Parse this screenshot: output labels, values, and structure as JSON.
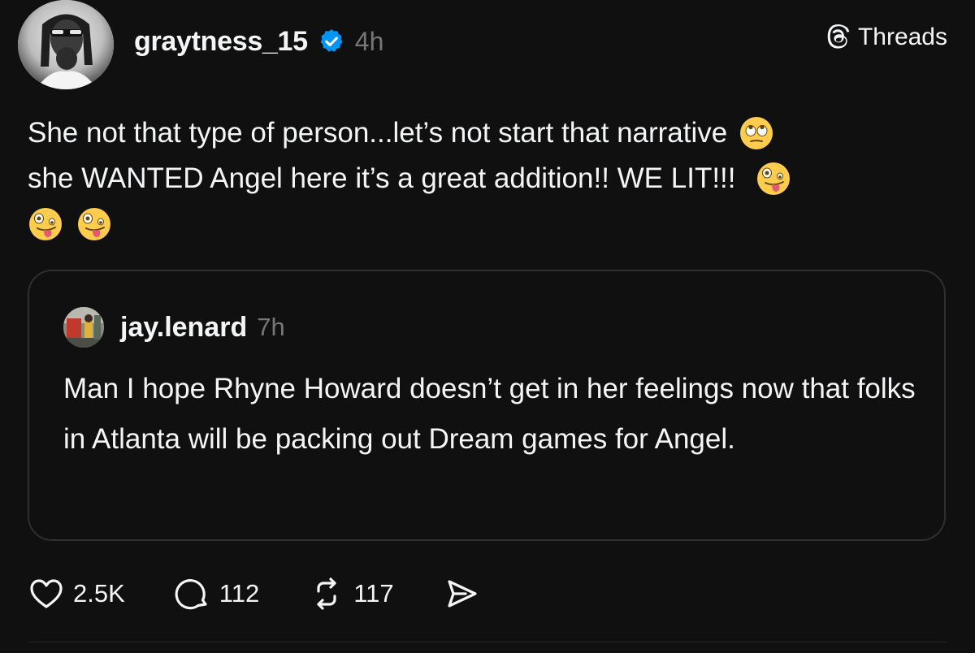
{
  "post": {
    "author": {
      "username": "graytness_15",
      "time": "4h",
      "verified": true
    },
    "brand": {
      "label": "Threads",
      "icon": "threads-logo-icon"
    },
    "text_lines": [
      "She not that type of person...let’s not start that narrative",
      "she WANTED Angel here it’s a great addition!! WE LIT!!!"
    ],
    "emojis": {
      "line1": [
        "face-with-rolling-eyes-emoji"
      ],
      "line2": [
        "zany-face-emoji"
      ],
      "line3": [
        "zany-face-emoji",
        "zany-face-emoji"
      ]
    },
    "quoted_post": {
      "username": "jay.lenard",
      "time": "7h",
      "text": "Man I hope Rhyne Howard doesn’t get in her feelings now that folks in Atlanta will be packing out Dream games for Angel."
    },
    "actions": {
      "likes": "2.5K",
      "replies": "112",
      "reposts": "117"
    }
  },
  "colors": {
    "background": "#101010",
    "text": "#f3f5f7",
    "muted": "#777777",
    "verified": "#0095f6",
    "border": "#2f2f2f"
  }
}
